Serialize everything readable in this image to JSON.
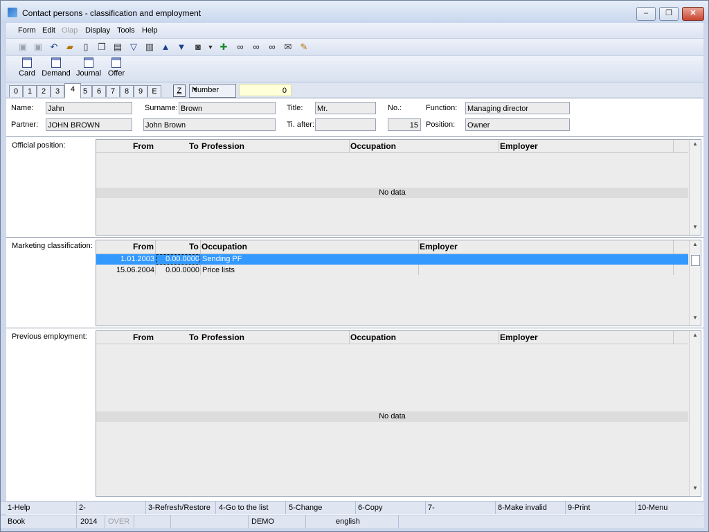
{
  "window": {
    "title": "Contact persons - classification and employment"
  },
  "menu": [
    "Form",
    "Edit",
    "Olap",
    "Display",
    "Tools",
    "Help"
  ],
  "toolbar_icons": [
    "save-icon",
    "save-all-icon",
    "undo-icon",
    "open-icon",
    "new-icon",
    "copy-icon",
    "book-icon",
    "filter-icon",
    "filter-clear-icon",
    "up-arrow-icon",
    "down-arrow-icon",
    "camera-icon",
    "dropdown-icon",
    "import-icon",
    "binoculars-icon",
    "binoculars-next-icon",
    "binoculars-prev-icon",
    "email-icon",
    "notepad-icon"
  ],
  "toolbar2": {
    "card": "Card",
    "demand": "Demand",
    "journal": "Journal",
    "offer": "Offer"
  },
  "tabs": [
    "0",
    "1",
    "2",
    "3",
    "4",
    "5",
    "6",
    "7",
    "8",
    "9",
    "E"
  ],
  "active_tab": "4",
  "z_button": "Z",
  "sort_select": "Number",
  "number_value": "0",
  "header": {
    "name_label": "Name:",
    "name": "Jahn",
    "surname_label": "Surname:",
    "surname": "Brown",
    "title_label": "Title:",
    "title": "Mr.",
    "no_label": "No.:",
    "function_label": "Function:",
    "function": "Managing director",
    "partner_label": "Partner:",
    "partner": "JOHN BROWN",
    "partner_name": "John Brown",
    "ti_after_label": "Ti. after:",
    "ti_after": "",
    "no_value": "15",
    "position_label": "Position:",
    "position": "Owner"
  },
  "official": {
    "label": "Official position:",
    "columns": {
      "from": "From",
      "to": "To",
      "profession": "Profession",
      "occupation": "Occupation",
      "employer": "Employer"
    },
    "empty": "No data"
  },
  "marketing": {
    "label": "Marketing classification:",
    "columns": {
      "from": "From",
      "to": "To",
      "occupation": "Occupation",
      "employer": "Employer"
    },
    "rows": [
      {
        "from": "1.01.2003",
        "to": "0.00.0000",
        "occupation": "Sending PF",
        "employer": ""
      },
      {
        "from": "15.06.2004",
        "to": "0.00.0000",
        "occupation": "Price lists",
        "employer": ""
      }
    ]
  },
  "previous": {
    "label": "Previous employment:",
    "columns": {
      "from": "From",
      "to": "To",
      "profession": "Profession",
      "occupation": "Occupation",
      "employer": "Employer"
    },
    "empty": "No data"
  },
  "fkeys": [
    "1-Help",
    "2-",
    "3-Refresh/Restore",
    "4-Go to the list",
    "5-Change",
    "6-Copy",
    "7-",
    "8-Make invalid",
    "9-Print",
    "10-Menu"
  ],
  "status": {
    "book": "Book",
    "year": "2014",
    "mode": "OVER",
    "db": "DEMO",
    "lang": "english"
  }
}
